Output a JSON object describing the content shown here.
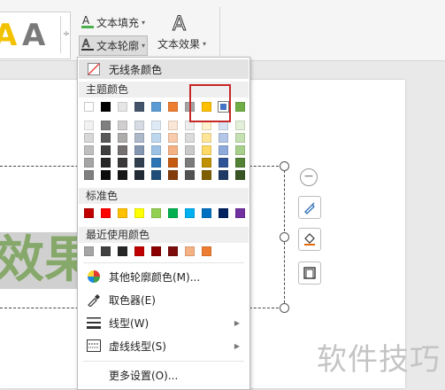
{
  "ribbon": {
    "text_fill_label": "文本填充",
    "text_outline_label": "文本轮廓",
    "text_effect_label": "文本效果",
    "style_sample_glyph": "A",
    "more_glyph": "÷"
  },
  "slide": {
    "effect_text": "效果",
    "watermark": "软件技巧"
  },
  "menu": {
    "no_line_color": "无线条颜色",
    "theme_colors_label": "主题颜色",
    "standard_colors_label": "标准色",
    "recent_colors_label": "最近使用颜色",
    "other_colors": "其他轮廓颜色(M)...",
    "eyedropper": "取色器(E)",
    "line_type": "线型(W)",
    "dash_type": "虚线线型(S)",
    "more_settings": "更多设置(O)..."
  },
  "colors": {
    "theme_top": [
      "#ffffff",
      "#000000",
      "#e7e6e6",
      "#44546a",
      "#5b9bd5",
      "#ed7d31",
      "#a5a5a5",
      "#ffc000",
      "#4472c4",
      "#70ad47"
    ],
    "theme_shades": [
      [
        "#f2f2f2",
        "#7f7f7f",
        "#d0cece",
        "#d6dce4",
        "#deebf6",
        "#fbe5d5",
        "#ededed",
        "#fff2cc",
        "#d9e2f3",
        "#e2efd9"
      ],
      [
        "#d8d8d8",
        "#595959",
        "#aeabab",
        "#adb9ca",
        "#bdd7ee",
        "#f7cbac",
        "#dbdbdb",
        "#fee599",
        "#b4c6e7",
        "#c5e0b3"
      ],
      [
        "#bfbfbf",
        "#3f3f3f",
        "#757070",
        "#8496b0",
        "#9cc3e5",
        "#f4b183",
        "#c9c9c9",
        "#ffd965",
        "#8eaadb",
        "#a8d08d"
      ],
      [
        "#a5a5a5",
        "#262626",
        "#3a3838",
        "#323f4f",
        "#2e75b5",
        "#c55a11",
        "#7b7b7b",
        "#bf9000",
        "#2f5496",
        "#538135"
      ],
      [
        "#7f7f7f",
        "#0c0c0c",
        "#171616",
        "#222a35",
        "#1e4e79",
        "#833c0b",
        "#525252",
        "#7f6000",
        "#1f3864",
        "#375623"
      ]
    ],
    "standard": [
      "#c00000",
      "#ff0000",
      "#ffc000",
      "#ffff00",
      "#92d050",
      "#00b050",
      "#00b0f0",
      "#0070c0",
      "#002060",
      "#7030a0"
    ],
    "recent": [
      "#a5a5a5",
      "#404040",
      "#262626",
      "#c00000",
      "#8b0000",
      "#7b0c0c",
      "#f4b183",
      "#ed7d31"
    ],
    "highlight": "#c62828",
    "effect_text": "#86a86a"
  },
  "icons": [
    "text-fill-icon",
    "text-outline-icon",
    "text-effect-icon",
    "no-color-icon",
    "palette-icon",
    "eyedropper-icon",
    "line-type-icon",
    "dash-type-icon",
    "pen-icon",
    "fill-bucket-icon",
    "outline-square-icon",
    "minus-icon"
  ]
}
